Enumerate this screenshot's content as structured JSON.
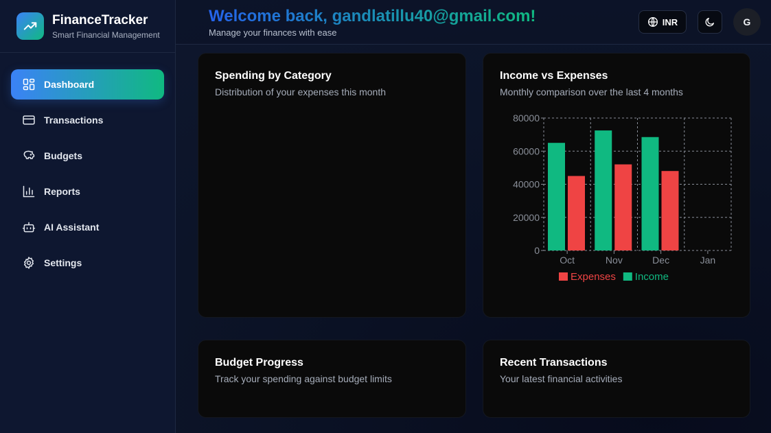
{
  "brand": {
    "name": "FinanceTracker",
    "subtitle": "Smart Financial Management",
    "logo_icon": "trending-up-icon"
  },
  "sidebar": {
    "items": [
      {
        "label": "Dashboard",
        "icon": "dashboard-icon",
        "active": true
      },
      {
        "label": "Transactions",
        "icon": "credit-card-icon",
        "active": false
      },
      {
        "label": "Budgets",
        "icon": "piggy-bank-icon",
        "active": false
      },
      {
        "label": "Reports",
        "icon": "bar-chart-icon",
        "active": false
      },
      {
        "label": "AI Assistant",
        "icon": "bot-icon",
        "active": false
      },
      {
        "label": "Settings",
        "icon": "settings-icon",
        "active": false
      }
    ]
  },
  "header": {
    "welcome": "Welcome back, gandlatillu40@gmail.com!",
    "subtitle": "Manage your finances with ease",
    "currency": "INR",
    "avatar_initial": "G"
  },
  "cards": {
    "spending": {
      "title": "Spending by Category",
      "subtitle": "Distribution of your expenses this month"
    },
    "income_expenses": {
      "title": "Income vs Expenses",
      "subtitle": "Monthly comparison over the last 4 months"
    },
    "budget": {
      "title": "Budget Progress",
      "subtitle": "Track your spending against budget limits"
    },
    "recent": {
      "title": "Recent Transactions",
      "subtitle": "Your latest financial activities"
    }
  },
  "colors": {
    "income": "#10b981",
    "expenses": "#ef4444",
    "accent_blue": "#3b82f6",
    "accent_green": "#10b981"
  },
  "chart_data": {
    "type": "bar",
    "categories": [
      "Oct",
      "Nov",
      "Dec",
      "Jan"
    ],
    "series": [
      {
        "name": "Income",
        "values": [
          65000,
          72500,
          68500,
          0
        ]
      },
      {
        "name": "Expenses",
        "values": [
          45000,
          52000,
          48000,
          0
        ]
      }
    ],
    "yticks": [
      0,
      20000,
      40000,
      60000,
      80000
    ],
    "ylim": [
      0,
      80000
    ],
    "grid": true,
    "legend": [
      "Expenses",
      "Income"
    ],
    "legend_position": "bottom"
  }
}
